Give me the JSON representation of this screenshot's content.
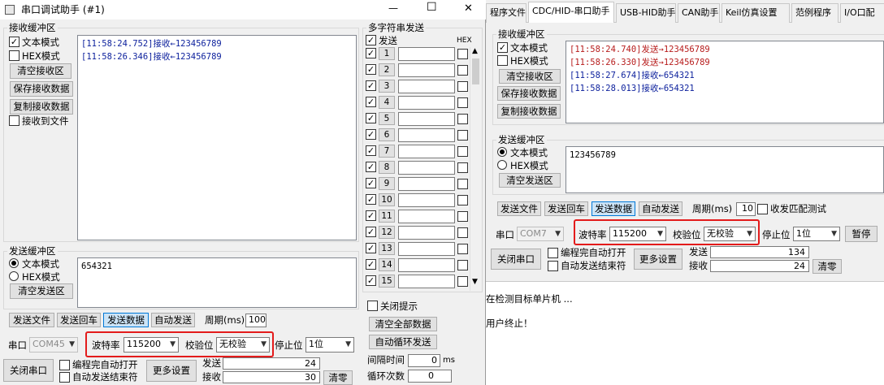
{
  "right": {
    "tabs": [
      "程序文件",
      "CDC/HID-串口助手",
      "USB-HID助手",
      "CAN助手",
      "Keil仿真设置",
      "范例程序",
      "I/O口配"
    ],
    "recv_group": "接收缓冲区",
    "text_mode": "文本模式",
    "hex_mode": "HEX模式",
    "clear_recv": "清空接收区",
    "save_recv": "保存接收数据",
    "copy_recv": "复制接收数据",
    "log": [
      {
        "t": "[11:58:24.740]发送→123456789",
        "k": "send"
      },
      {
        "t": "[11:58:26.330]发送→123456789",
        "k": "send"
      },
      {
        "t": "[11:58:27.674]接收←654321",
        "k": "recv"
      },
      {
        "t": "[11:58:28.013]接收←654321",
        "k": "recv"
      }
    ],
    "send_group": "发送缓冲区",
    "send_text": "123456789",
    "clear_send": "清空发送区",
    "send_file": "发送文件",
    "send_return": "发送回车",
    "send_data": "发送数据",
    "auto_send": "自动发送",
    "period_label": "周期(ms)",
    "period": "10",
    "match_test": "收发匹配测试",
    "port_label": "串口",
    "port": "COM7",
    "baud_label": "波特率",
    "baud": "115200",
    "parity_label": "校验位",
    "parity": "无校验",
    "stop_label": "停止位",
    "stop": "1位",
    "pause": "暂停",
    "close_port": "关闭串口",
    "auto_open": "编程完自动打开",
    "auto_send_end": "自动发送结束符",
    "more": "更多设置",
    "sent_label": "发送",
    "sent": "134",
    "recv_label": "接收",
    "recv": "24",
    "clear": "清零",
    "status1": "在检测目标单片机 ...",
    "status2": "用户终止！"
  },
  "left": {
    "title": "串口调试助手 (#1)",
    "min": "—",
    "max": "☐",
    "close": "✕",
    "recv_group": "接收缓冲区",
    "text_mode": "文本模式",
    "hex_mode": "HEX模式",
    "clear_recv": "清空接收区",
    "save_recv": "保存接收数据",
    "copy_recv": "复制接收数据",
    "recv_to_file": "接收到文件",
    "log": [
      {
        "t": "[11:58:24.752]接收←123456789",
        "k": "recv"
      },
      {
        "t": "[11:58:26.346]接收←123456789",
        "k": "recv"
      }
    ],
    "send_group": "发送缓冲区",
    "send_text": "654321",
    "clear_send": "清空发送区",
    "send_file": "发送文件",
    "send_return": "发送回车",
    "send_data": "发送数据",
    "auto_send": "自动发送",
    "period_label": "周期(ms)",
    "period": "100",
    "port_label": "串口",
    "port": "COM45",
    "baud_label": "波特率",
    "baud": "115200",
    "parity_label": "校验位",
    "parity": "无校验",
    "stop_label": "停止位",
    "stop": "1位",
    "close_port": "关闭串口",
    "auto_open": "编程完自动打开",
    "auto_send_end": "自动发送结束符",
    "more": "更多设置",
    "sent_label": "发送",
    "sent": "24",
    "recv_label": "接收",
    "recv": "30",
    "clear": "清零"
  },
  "multi": {
    "group": "多字符串发送",
    "send_col": "发送",
    "hex_col": "HEX",
    "rows": [
      "1",
      "2",
      "3",
      "4",
      "5",
      "6",
      "7",
      "8",
      "9",
      "10",
      "11",
      "12",
      "13",
      "14",
      "15"
    ],
    "close_tip": "关闭提示",
    "clear_all": "清空全部数据",
    "auto_loop": "自动循环发送",
    "interval_label": "间隔时间",
    "interval": "0",
    "interval_unit": "ms",
    "loop_label": "循环次数",
    "loop": "0"
  }
}
